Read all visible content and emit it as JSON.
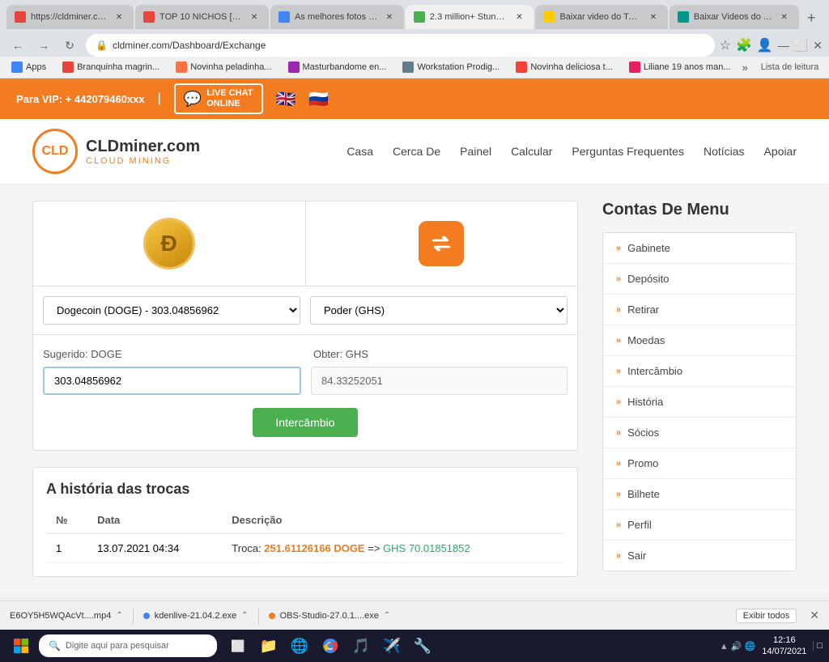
{
  "browser": {
    "address": "cldminer.com/Dashboard/Exchange",
    "tabs": [
      {
        "id": "t1",
        "favicon_color": "#e8453c",
        "title": "https://cldminer.co...",
        "active": false
      },
      {
        "id": "t2",
        "favicon_color": "#e8453c",
        "title": "TOP 10 NICHOS [B...",
        "active": false
      },
      {
        "id": "t3",
        "favicon_color": "#4285f4",
        "title": "As melhores fotos c...",
        "active": false
      },
      {
        "id": "t4",
        "favicon_color": "#4caf50",
        "title": "2.3 million+ Stunni...",
        "active": true
      },
      {
        "id": "t5",
        "favicon_color": "#ffcc00",
        "title": "Baixar video do Twi...",
        "active": false
      },
      {
        "id": "t6",
        "favicon_color": "#009688",
        "title": "Baixar Videos do T...",
        "active": false
      }
    ],
    "bookmarks": [
      {
        "label": "Apps"
      },
      {
        "label": "Branquinha magrin..."
      },
      {
        "label": "Novinha peladinha..."
      },
      {
        "label": "Masturbandome en..."
      },
      {
        "label": "Workstation Prodig..."
      },
      {
        "label": "Novinha deliciosa t..."
      },
      {
        "label": "Liliane 19 anos man..."
      }
    ],
    "more_label": "»",
    "reading_list": "Lista de leitura"
  },
  "topbar": {
    "phone_label": "Para VIP: + 442079460xxx",
    "live_chat_line1": "LIVE CHAT",
    "live_chat_line2": "ONLINE"
  },
  "nav": {
    "logo_main": "CLDminer.com",
    "logo_sub": "CLOUD MINING",
    "links": [
      "Casa",
      "Cerca De",
      "Painel",
      "Calcular",
      "Perguntas Frequentes",
      "Notícias",
      "Apoiar"
    ]
  },
  "exchange": {
    "from_select_value": "Dogecoin (DOGE) - 303.04856962",
    "to_select_value": "Poder (GHS)",
    "from_label": "Sugerido: DOGE",
    "to_label": "Obter: GHS",
    "from_value": "303.04856962",
    "to_value": "84.33252051",
    "submit_label": "Intercâmbio"
  },
  "history": {
    "title": "A história das trocas",
    "columns": [
      "№",
      "Data",
      "Descrição"
    ],
    "rows": [
      {
        "num": "1",
        "date": "13.07.2021 04:34",
        "description_prefix": "Troca: ",
        "doge_amount": "251.61126166 DOGE",
        "arrow": " => ",
        "ghs_amount": "GHS 70.01851852"
      }
    ]
  },
  "sidebar": {
    "title": "Contas De Menu",
    "items": [
      {
        "label": "Gabinete",
        "id": "gabinete"
      },
      {
        "label": "Depósito",
        "id": "deposito"
      },
      {
        "label": "Retirar",
        "id": "retirar"
      },
      {
        "label": "Moedas",
        "id": "moedas"
      },
      {
        "label": "Intercâmbio",
        "id": "intercambio"
      },
      {
        "label": "História",
        "id": "historia"
      },
      {
        "label": "Sócios",
        "id": "socios"
      },
      {
        "label": "Promo",
        "id": "promo"
      },
      {
        "label": "Bilhete",
        "id": "bilhete"
      },
      {
        "label": "Perfil",
        "id": "perfil"
      },
      {
        "label": "Sair",
        "id": "sair"
      }
    ]
  },
  "downloads": {
    "items": [
      {
        "name": "E6OY5H5WQAcVt....mp4",
        "icon_color": "#555"
      },
      {
        "name": "kdenlive-21.04.2.exe",
        "icon_color": "#4285f4"
      },
      {
        "name": "OBS-Studio-27.0.1....exe",
        "icon_color": "#f37c20"
      }
    ],
    "show_all": "Exibir todos"
  },
  "taskbar": {
    "search_placeholder": "Digite aqui para pesquisar",
    "time": "12:16",
    "date": "14/07/2021"
  }
}
